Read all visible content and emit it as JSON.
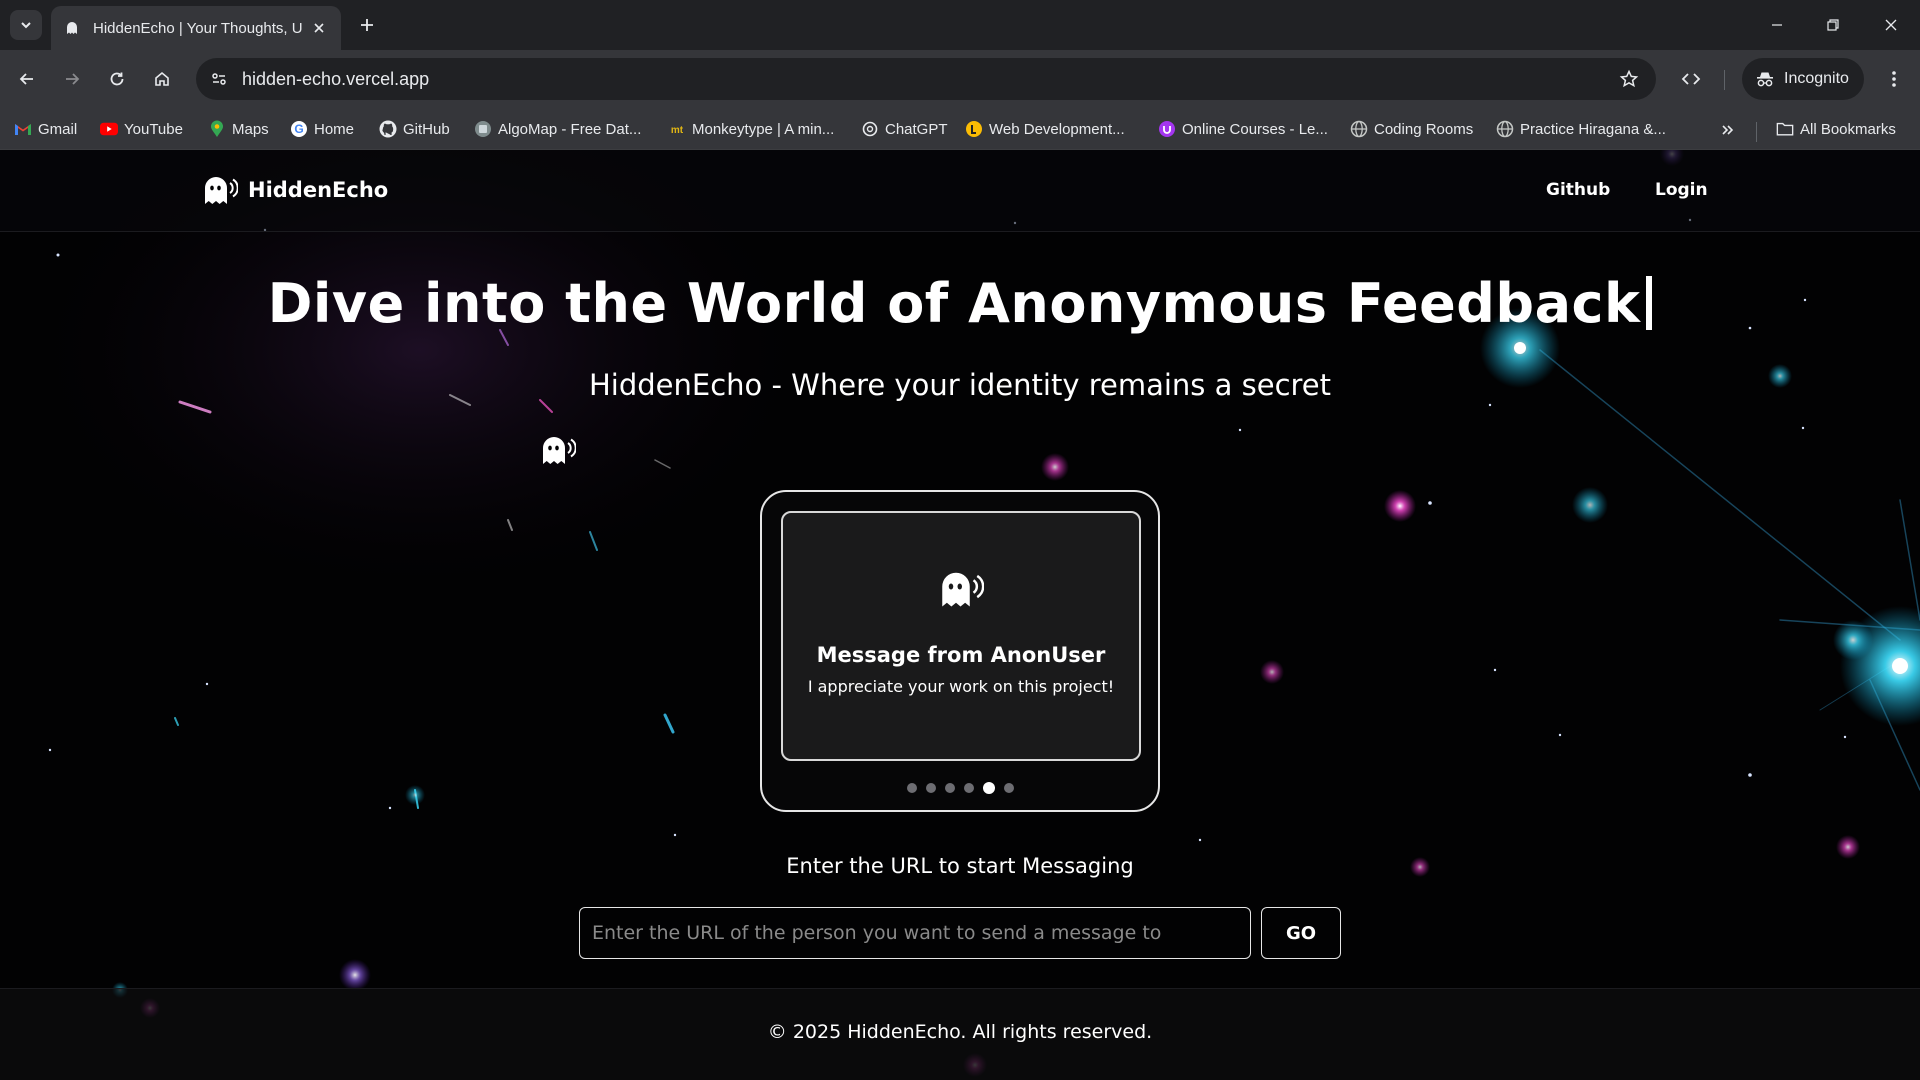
{
  "browser": {
    "tab": {
      "title": "HiddenEcho | Your Thoughts, Unfiltered",
      "favicon": "ghost-icon"
    },
    "address_bar": {
      "url": "hidden-echo.vercel.app"
    },
    "profile": {
      "label": "Incognito"
    },
    "bookmarks": [
      {
        "label": "Gmail",
        "icon": "gmail-icon"
      },
      {
        "label": "YouTube",
        "icon": "youtube-icon"
      },
      {
        "label": "Maps",
        "icon": "maps-icon"
      },
      {
        "label": "Home",
        "icon": "google-icon"
      },
      {
        "label": "GitHub",
        "icon": "github-icon"
      },
      {
        "label": "AlgoMap - Free Dat...",
        "icon": "algomap-icon"
      },
      {
        "label": "Monkeytype | A min...",
        "icon": "monkeytype-icon"
      },
      {
        "label": "ChatGPT",
        "icon": "chatgpt-icon"
      },
      {
        "label": "Web Development...",
        "icon": "webdev-icon"
      },
      {
        "label": "Online Courses - Le...",
        "icon": "udemy-icon"
      },
      {
        "label": "Coding Rooms",
        "icon": "globe-icon"
      },
      {
        "label": "Practice Hiragana &...",
        "icon": "globe-icon"
      }
    ],
    "all_bookmarks_label": "All Bookmarks"
  },
  "site": {
    "brand": "HiddenEcho",
    "nav": {
      "github": "Github",
      "login": "Login"
    },
    "hero": {
      "title": "Dive into the World of Anonymous Feedback",
      "subtitle": "HiddenEcho - Where your identity remains a secret"
    },
    "carousel": {
      "title": "Message from AnonUser",
      "message": "I appreciate your work on this project!",
      "slide_count": 6,
      "active_index": 4
    },
    "cta": {
      "label": "Enter the URL to start Messaging",
      "placeholder": "Enter the URL of the person you want to send a message to",
      "button": "GO"
    },
    "footer": "© 2025 HiddenEcho. All rights reserved."
  },
  "colors": {
    "chrome_dark": "#202124",
    "chrome_toolbar": "#35363a",
    "page_background": "#020203",
    "card_background": "#1a1a1b",
    "accent_cyan": "#36d6ff",
    "accent_magenta": "#ff3fd1"
  }
}
